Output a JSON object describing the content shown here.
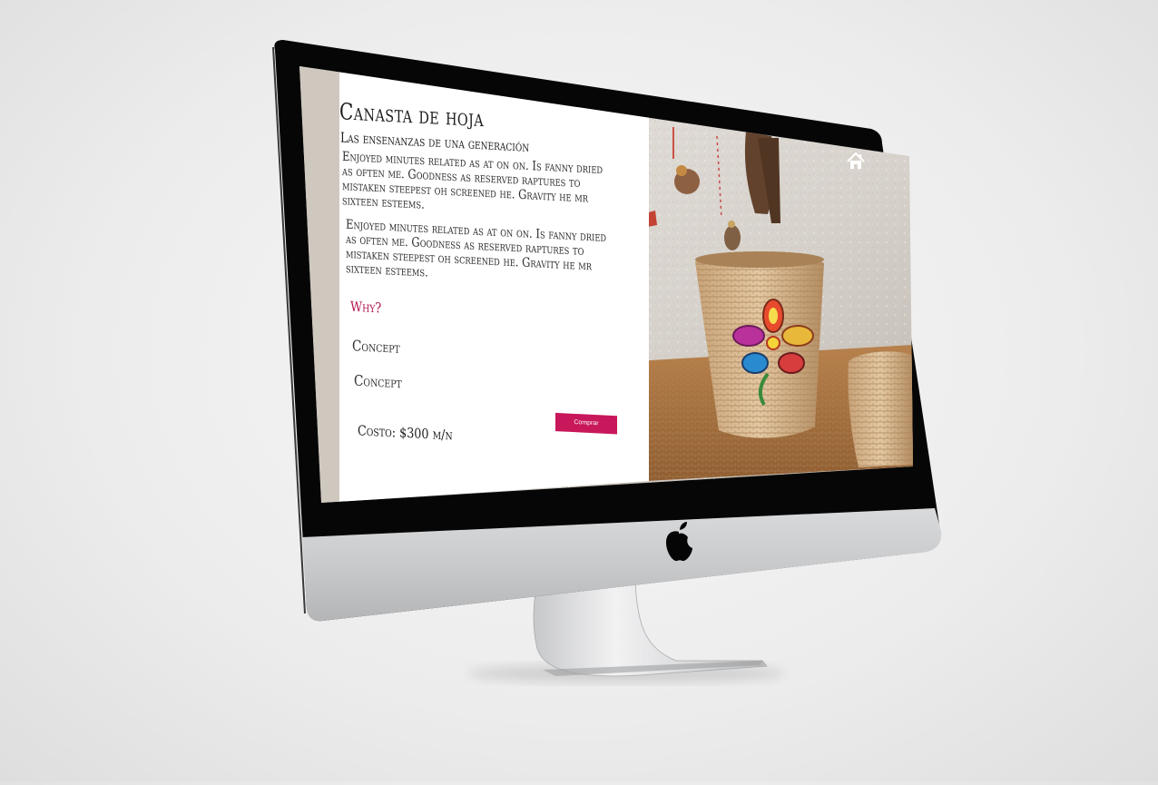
{
  "product": {
    "title": "Canasta de hoja",
    "subtitle": "Las ensenanzas de una generación",
    "paragraphs": [
      "Enjoyed minutes related as at on on. Is fanny dried as often me. Goodness as reserved raptures to mistaken steepest oh screened he. Gravity he mr sixteen esteems.",
      "Enjoyed minutes related as at on on. Is fanny dried as often me. Goodness as reserved raptures to mistaken steepest oh screened he. Gravity he mr sixteen esteems."
    ],
    "why_label": "Why?",
    "concepts": [
      "Concept",
      "Concept"
    ],
    "cost": "Costo: $300 m/n",
    "buy_label": "Comprar"
  },
  "nav": {
    "home_icon": "home-icon"
  },
  "colors": {
    "accent": "#c8175a",
    "why_text": "#b3124e",
    "panel_bg": "#ffffff",
    "bezel": "#050505",
    "chassis": "#cfd0d2"
  },
  "icons": {
    "brand": "apple-logo-icon",
    "home": "home-icon"
  }
}
